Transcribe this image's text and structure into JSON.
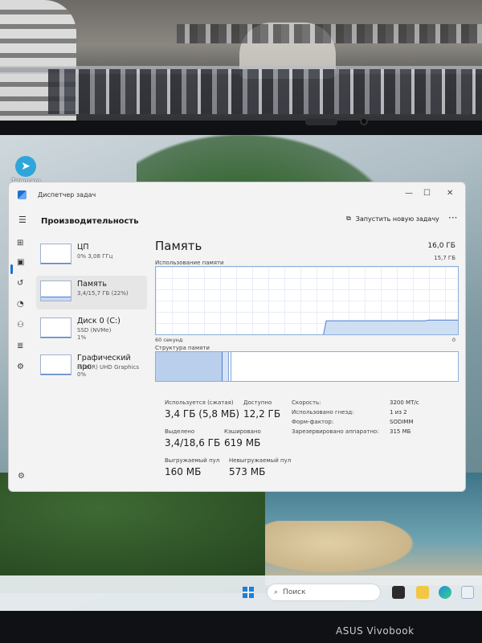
{
  "desktop": {
    "icon_label": "Telegram"
  },
  "window": {
    "title": "Диспетчер задач",
    "controls": [
      "—",
      "☐",
      "✕"
    ]
  },
  "header": {
    "page_title": "Производительность",
    "run_task_label": "Запустить новую задачу",
    "more": "···"
  },
  "sidebar": {
    "items": [
      {
        "name": "ЦП",
        "sub1": "0% 3,08 ГГц",
        "sub2": "",
        "fill": 0.05
      },
      {
        "name": "Память",
        "sub1": "3,4/15,7 ГБ (22%)",
        "sub2": "",
        "fill": 0.22
      },
      {
        "name": "Диск 0 (C:)",
        "sub1": "SSD (NVMe)",
        "sub2": "1%",
        "fill": 0.01
      },
      {
        "name": "Графический про",
        "sub1": "Intel(R) UHD Graphics",
        "sub2": "0%",
        "fill": 0.0
      }
    ]
  },
  "memory": {
    "title": "Память",
    "total": "16,0 ГБ",
    "usage_label": "Использование памяти",
    "usage_max": "15,7 ГБ",
    "seconds_label": "60 секунд",
    "zero_label": "0",
    "structure_label": "Структура памяти",
    "structure": {
      "in_use": 0.22,
      "modified": 0.02,
      "standby": 0.01
    },
    "stats": {
      "in_use": {
        "label": "Используется (сжатая)",
        "value": "3,4 ГБ (5,8 МБ)"
      },
      "available": {
        "label": "Доступно",
        "value": "12,2 ГБ"
      },
      "committed": {
        "label": "Выделено",
        "value": "3,4/18,6 ГБ"
      },
      "cached": {
        "label": "Кэшировано",
        "value": "619 МБ"
      },
      "paged_pool": {
        "label": "Выгружаемый пул",
        "value": "160 МБ"
      },
      "nonpaged_pool": {
        "label": "Невыгружаемый пул",
        "value": "573 МБ"
      }
    },
    "specs": [
      {
        "key": "Скорость:",
        "value": "3200 MT/c"
      },
      {
        "key": "Использовано гнезд:",
        "value": "1 из 2"
      },
      {
        "key": "Форм-фактор:",
        "value": "SODIMM"
      },
      {
        "key": "Зарезервировано аппаратно:",
        "value": "315 МБ"
      }
    ],
    "history": [
      0,
      0,
      0,
      0,
      0,
      0,
      0,
      0,
      0,
      0,
      0,
      0,
      0,
      0,
      0,
      0,
      0,
      0,
      0,
      0,
      0,
      0,
      0,
      0,
      0,
      0,
      0,
      0,
      0,
      0,
      0,
      0,
      0,
      0,
      0,
      0,
      0,
      0,
      0,
      0,
      0,
      0,
      0,
      0,
      0,
      0,
      0,
      0,
      0,
      0,
      0,
      0,
      0,
      0,
      0,
      0.22,
      0.22,
      0.22,
      0.22,
      0.22,
      0.22,
      0.22,
      0.22,
      0.22,
      0.22,
      0.22,
      0.22,
      0.22,
      0.22,
      0.22,
      0.22,
      0.22,
      0.22,
      0.22,
      0.22,
      0.22,
      0.22,
      0.22,
      0.22,
      0.22,
      0.22,
      0.22,
      0.22,
      0.22,
      0.22,
      0.22,
      0.22,
      0.22,
      0.23,
      0.23,
      0.23,
      0.23,
      0.23,
      0.23,
      0.23,
      0.23,
      0.23,
      0.23,
      0.23
    ]
  },
  "taskbar": {
    "search_placeholder": "Поиск"
  },
  "device_brand": "ASUS Vivobook",
  "colors": {
    "accent": "#1f6fd1",
    "graph_line": "#4b7fcf",
    "graph_fill": "#c7d9f1"
  }
}
